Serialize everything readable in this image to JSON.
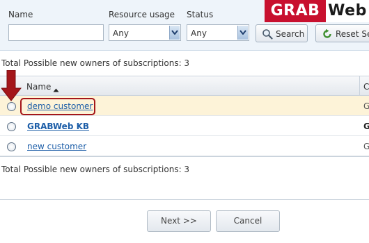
{
  "filters": {
    "name_label": "Name",
    "name_value": "",
    "resource_label": "Resource usage",
    "resource_value": "Any",
    "status_label": "Status",
    "status_value": "Any",
    "search_label": "Search",
    "reset_label": "Reset Se"
  },
  "logo": {
    "part1": "GRAB",
    "part2": "Web"
  },
  "summary_top": "Total Possible new owners of subscriptions: 3",
  "summary_bottom": "Total Possible new owners of subscriptions: 3",
  "table": {
    "col_name": "Name",
    "col_next": "C",
    "rows": [
      {
        "name": "demo customer",
        "next": "G"
      },
      {
        "name": "GRABWeb KB",
        "next": "G"
      },
      {
        "name": "new customer",
        "next": "G"
      }
    ]
  },
  "actions": {
    "next_label": "Next >>",
    "cancel_label": "Cancel"
  },
  "colors": {
    "accent_red": "#a4161a",
    "link_blue": "#1d5ea8",
    "selected_row": "#fdf3d8",
    "panel_bg": "#eef4fa"
  }
}
